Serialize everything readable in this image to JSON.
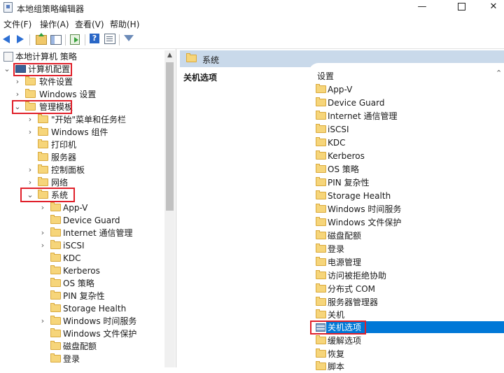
{
  "window": {
    "title": "本地组策略编辑器",
    "minimize": "—",
    "close": "✕"
  },
  "menu": [
    "文件(F)",
    "操作(A)",
    "查看(V)",
    "帮助(H)"
  ],
  "tree": {
    "root": "本地计算机 策略",
    "computer_config": "计算机配置",
    "software_settings": "软件设置",
    "windows_settings": "Windows 设置",
    "admin_templates": "管理模板",
    "start_menu": "\"开始\"菜单和任务栏",
    "windows_components": "Windows 组件",
    "printers": "打印机",
    "server": "服务器",
    "control_panel": "控制面板",
    "network": "网络",
    "system": "系统",
    "system_children": [
      "App-V",
      "Device Guard",
      "Internet 通信管理",
      "iSCSI",
      "KDC",
      "Kerberos",
      "OS 策略",
      "PIN 复杂性",
      "Storage Health",
      "Windows 时间服务",
      "Windows 文件保护",
      "磁盘配额",
      "登录"
    ]
  },
  "right": {
    "header": "系统",
    "extended_title": "关机选项",
    "column_header": "设置",
    "items": [
      "App-V",
      "Device Guard",
      "Internet 通信管理",
      "iSCSI",
      "KDC",
      "Kerberos",
      "OS 策略",
      "PIN 复杂性",
      "Storage Health",
      "Windows 时间服务",
      "Windows 文件保护",
      "磁盘配额",
      "登录",
      "电源管理",
      "访问被拒绝协助",
      "分布式 COM",
      "服务器管理器",
      "关机",
      "关机选项",
      "缓解选项",
      "恢复",
      "脚本"
    ],
    "selected": "关机选项"
  },
  "colors": {
    "highlight_box": "#e0202a",
    "selection": "#0078d7",
    "header_bg": "#c9d9ea"
  }
}
